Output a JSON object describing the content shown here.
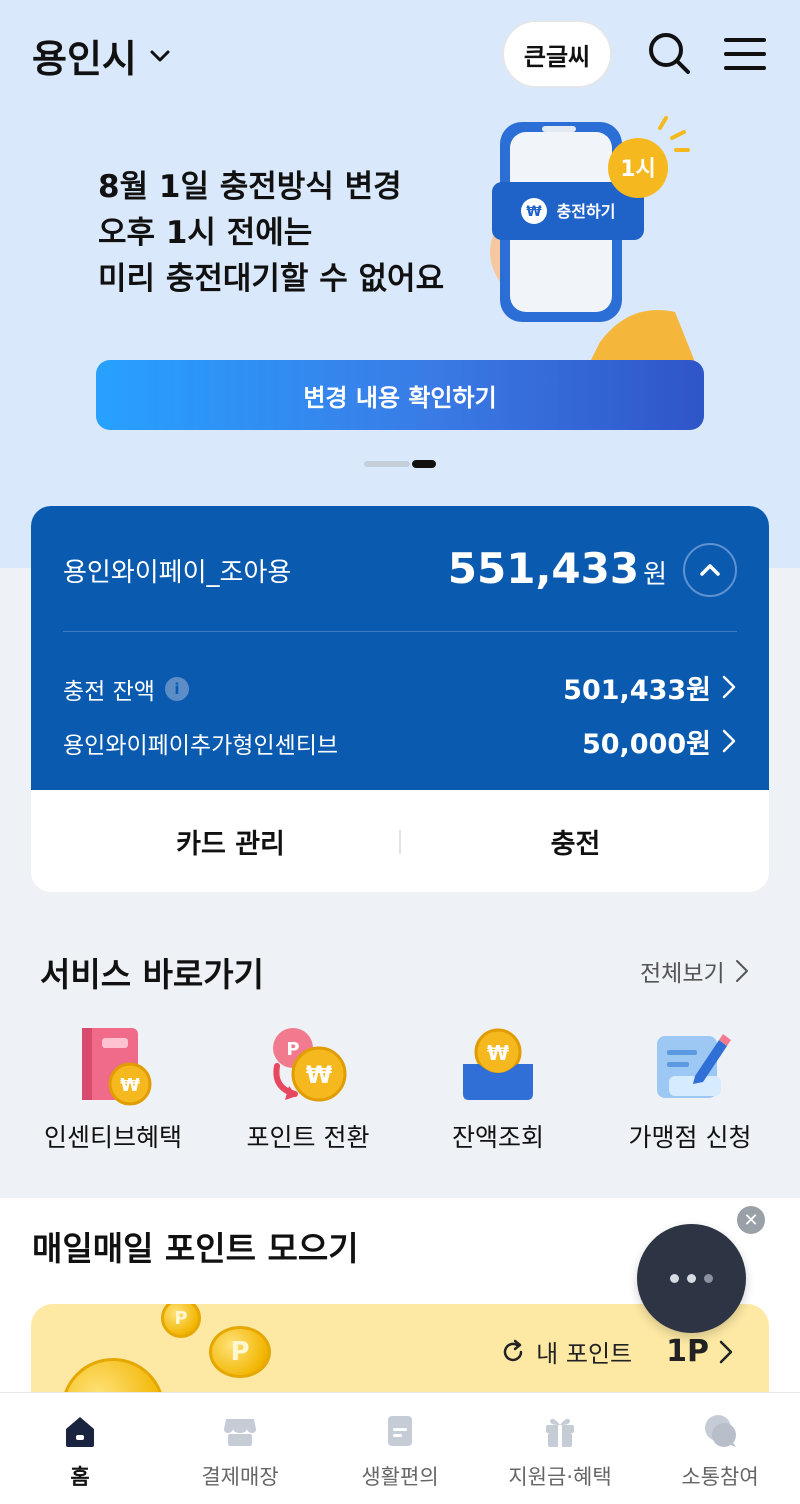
{
  "header": {
    "city": "용인시",
    "big_font_label": "큰글씨"
  },
  "banner": {
    "lines": [
      "8월 1일 충전방식 변경",
      "오후 1시 전에는",
      "미리 충전대기할 수 없어요"
    ],
    "art_badge": "1시",
    "art_button": "충전하기",
    "cta_label": "변경 내용 확인하기"
  },
  "wallet": {
    "name": "용인와이페이_조아용",
    "total": "551,433",
    "total_unit": "원",
    "rows": [
      {
        "label": "충전 잔액",
        "value": "501,433원"
      },
      {
        "label": "용인와이페이추가형인센티브",
        "value": "50,000원"
      }
    ],
    "card_manage_label": "카드 관리",
    "charge_label": "충전"
  },
  "services": {
    "title": "서비스 바로가기",
    "view_all": "전체보기",
    "items": [
      {
        "label": "인센티브혜택",
        "icon": "incentive-book-icon"
      },
      {
        "label": "포인트 전환",
        "icon": "point-convert-icon"
      },
      {
        "label": "잔액조회",
        "icon": "wallet-coin-icon"
      },
      {
        "label": "가맹점 신청",
        "icon": "merchant-apply-icon"
      }
    ]
  },
  "daily": {
    "title": "매일매일 포인트 모으기",
    "my_point_label": "내 포인트",
    "my_point_value": "1P"
  },
  "tabs": [
    {
      "label": "홈",
      "icon": "home-icon",
      "active": true
    },
    {
      "label": "결제매장",
      "icon": "store-icon"
    },
    {
      "label": "생활편의",
      "icon": "document-icon"
    },
    {
      "label": "지원금·혜택",
      "icon": "gift-icon"
    },
    {
      "label": "소통참여",
      "icon": "chat-icon"
    }
  ],
  "colors": {
    "hero_bg": "#d9e9fb",
    "wallet_blue": "#0a5bb0",
    "cta_start": "#27a1ff",
    "cta_end": "#2f55c8",
    "point_card": "#fde9a4"
  }
}
